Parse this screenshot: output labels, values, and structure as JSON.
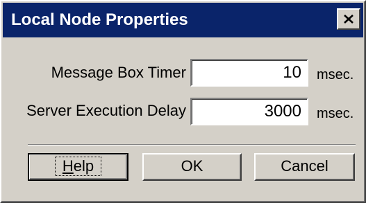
{
  "dialog": {
    "title": "Local Node Properties"
  },
  "fields": [
    {
      "label": "Message Box Timer",
      "value": "10",
      "unit": "msec."
    },
    {
      "label": "Server Execution Delay",
      "value": "3000",
      "unit": "msec."
    }
  ],
  "buttons": {
    "help_first": "H",
    "help_rest": "elp",
    "ok": "OK",
    "cancel": "Cancel"
  },
  "icons": {
    "close": "close-icon"
  },
  "colors": {
    "titlebar": "#0a246a",
    "face": "#d4d0c8"
  }
}
